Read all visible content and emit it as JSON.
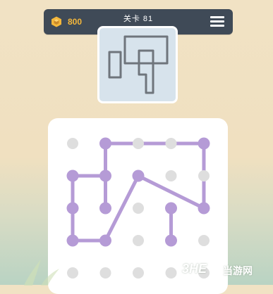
{
  "topbar": {
    "coins": "800",
    "level": "关卡 81",
    "coin_icon": "cube-coin-icon",
    "menu_icon": "hamburger-menu-icon"
  },
  "preview": {
    "icon": "target-shape-preview"
  },
  "board": {
    "line_color": "#b59bd6",
    "dot_color": "#dedede",
    "active_dot_color": "#b59bd6"
  },
  "watermark": {
    "logo": "3HE",
    "name": "当游网"
  }
}
